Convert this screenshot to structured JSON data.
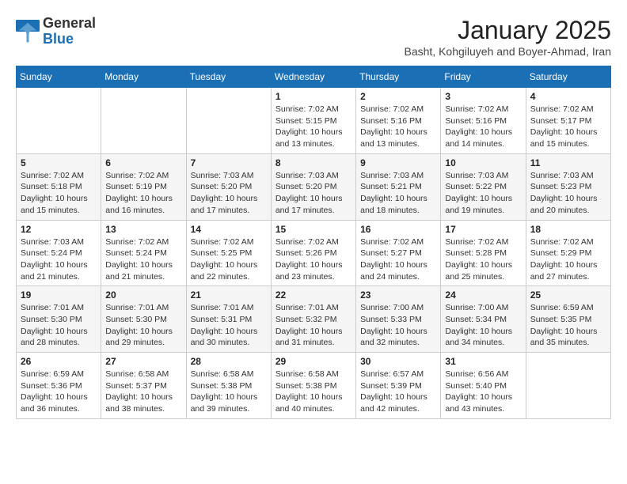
{
  "header": {
    "logo": {
      "general": "General",
      "blue": "Blue"
    },
    "title": "January 2025",
    "subtitle": "Basht, Kohgiluyeh and Boyer-Ahmad, Iran"
  },
  "weekdays": [
    "Sunday",
    "Monday",
    "Tuesday",
    "Wednesday",
    "Thursday",
    "Friday",
    "Saturday"
  ],
  "weeks": [
    [
      null,
      null,
      null,
      {
        "day": 1,
        "sunrise": "Sunrise: 7:02 AM",
        "sunset": "Sunset: 5:15 PM",
        "daylight": "Daylight: 10 hours and 13 minutes."
      },
      {
        "day": 2,
        "sunrise": "Sunrise: 7:02 AM",
        "sunset": "Sunset: 5:16 PM",
        "daylight": "Daylight: 10 hours and 13 minutes."
      },
      {
        "day": 3,
        "sunrise": "Sunrise: 7:02 AM",
        "sunset": "Sunset: 5:16 PM",
        "daylight": "Daylight: 10 hours and 14 minutes."
      },
      {
        "day": 4,
        "sunrise": "Sunrise: 7:02 AM",
        "sunset": "Sunset: 5:17 PM",
        "daylight": "Daylight: 10 hours and 15 minutes."
      }
    ],
    [
      {
        "day": 5,
        "sunrise": "Sunrise: 7:02 AM",
        "sunset": "Sunset: 5:18 PM",
        "daylight": "Daylight: 10 hours and 15 minutes."
      },
      {
        "day": 6,
        "sunrise": "Sunrise: 7:02 AM",
        "sunset": "Sunset: 5:19 PM",
        "daylight": "Daylight: 10 hours and 16 minutes."
      },
      {
        "day": 7,
        "sunrise": "Sunrise: 7:03 AM",
        "sunset": "Sunset: 5:20 PM",
        "daylight": "Daylight: 10 hours and 17 minutes."
      },
      {
        "day": 8,
        "sunrise": "Sunrise: 7:03 AM",
        "sunset": "Sunset: 5:20 PM",
        "daylight": "Daylight: 10 hours and 17 minutes."
      },
      {
        "day": 9,
        "sunrise": "Sunrise: 7:03 AM",
        "sunset": "Sunset: 5:21 PM",
        "daylight": "Daylight: 10 hours and 18 minutes."
      },
      {
        "day": 10,
        "sunrise": "Sunrise: 7:03 AM",
        "sunset": "Sunset: 5:22 PM",
        "daylight": "Daylight: 10 hours and 19 minutes."
      },
      {
        "day": 11,
        "sunrise": "Sunrise: 7:03 AM",
        "sunset": "Sunset: 5:23 PM",
        "daylight": "Daylight: 10 hours and 20 minutes."
      }
    ],
    [
      {
        "day": 12,
        "sunrise": "Sunrise: 7:03 AM",
        "sunset": "Sunset: 5:24 PM",
        "daylight": "Daylight: 10 hours and 21 minutes."
      },
      {
        "day": 13,
        "sunrise": "Sunrise: 7:02 AM",
        "sunset": "Sunset: 5:24 PM",
        "daylight": "Daylight: 10 hours and 21 minutes."
      },
      {
        "day": 14,
        "sunrise": "Sunrise: 7:02 AM",
        "sunset": "Sunset: 5:25 PM",
        "daylight": "Daylight: 10 hours and 22 minutes."
      },
      {
        "day": 15,
        "sunrise": "Sunrise: 7:02 AM",
        "sunset": "Sunset: 5:26 PM",
        "daylight": "Daylight: 10 hours and 23 minutes."
      },
      {
        "day": 16,
        "sunrise": "Sunrise: 7:02 AM",
        "sunset": "Sunset: 5:27 PM",
        "daylight": "Daylight: 10 hours and 24 minutes."
      },
      {
        "day": 17,
        "sunrise": "Sunrise: 7:02 AM",
        "sunset": "Sunset: 5:28 PM",
        "daylight": "Daylight: 10 hours and 25 minutes."
      },
      {
        "day": 18,
        "sunrise": "Sunrise: 7:02 AM",
        "sunset": "Sunset: 5:29 PM",
        "daylight": "Daylight: 10 hours and 27 minutes."
      }
    ],
    [
      {
        "day": 19,
        "sunrise": "Sunrise: 7:01 AM",
        "sunset": "Sunset: 5:30 PM",
        "daylight": "Daylight: 10 hours and 28 minutes."
      },
      {
        "day": 20,
        "sunrise": "Sunrise: 7:01 AM",
        "sunset": "Sunset: 5:30 PM",
        "daylight": "Daylight: 10 hours and 29 minutes."
      },
      {
        "day": 21,
        "sunrise": "Sunrise: 7:01 AM",
        "sunset": "Sunset: 5:31 PM",
        "daylight": "Daylight: 10 hours and 30 minutes."
      },
      {
        "day": 22,
        "sunrise": "Sunrise: 7:01 AM",
        "sunset": "Sunset: 5:32 PM",
        "daylight": "Daylight: 10 hours and 31 minutes."
      },
      {
        "day": 23,
        "sunrise": "Sunrise: 7:00 AM",
        "sunset": "Sunset: 5:33 PM",
        "daylight": "Daylight: 10 hours and 32 minutes."
      },
      {
        "day": 24,
        "sunrise": "Sunrise: 7:00 AM",
        "sunset": "Sunset: 5:34 PM",
        "daylight": "Daylight: 10 hours and 34 minutes."
      },
      {
        "day": 25,
        "sunrise": "Sunrise: 6:59 AM",
        "sunset": "Sunset: 5:35 PM",
        "daylight": "Daylight: 10 hours and 35 minutes."
      }
    ],
    [
      {
        "day": 26,
        "sunrise": "Sunrise: 6:59 AM",
        "sunset": "Sunset: 5:36 PM",
        "daylight": "Daylight: 10 hours and 36 minutes."
      },
      {
        "day": 27,
        "sunrise": "Sunrise: 6:58 AM",
        "sunset": "Sunset: 5:37 PM",
        "daylight": "Daylight: 10 hours and 38 minutes."
      },
      {
        "day": 28,
        "sunrise": "Sunrise: 6:58 AM",
        "sunset": "Sunset: 5:38 PM",
        "daylight": "Daylight: 10 hours and 39 minutes."
      },
      {
        "day": 29,
        "sunrise": "Sunrise: 6:58 AM",
        "sunset": "Sunset: 5:38 PM",
        "daylight": "Daylight: 10 hours and 40 minutes."
      },
      {
        "day": 30,
        "sunrise": "Sunrise: 6:57 AM",
        "sunset": "Sunset: 5:39 PM",
        "daylight": "Daylight: 10 hours and 42 minutes."
      },
      {
        "day": 31,
        "sunrise": "Sunrise: 6:56 AM",
        "sunset": "Sunset: 5:40 PM",
        "daylight": "Daylight: 10 hours and 43 minutes."
      },
      null
    ]
  ]
}
